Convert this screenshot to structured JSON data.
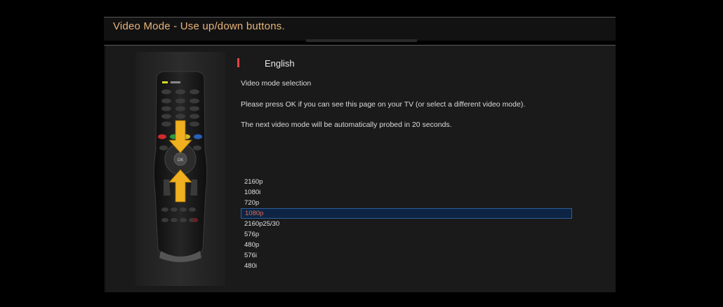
{
  "header": {
    "title": "Video Mode - Use up/down buttons."
  },
  "language": {
    "label": "English"
  },
  "description": {
    "heading": "Video mode selection",
    "instruction": "Please press OK if you can see this page on your TV (or select a different video mode).",
    "countdown": "The next video mode will be automatically probed in 20 seconds."
  },
  "video_modes": {
    "items": [
      "2160p",
      "1080i",
      "720p",
      "1080p",
      "2160p25/30",
      "576p",
      "480p",
      "576i",
      "480i"
    ],
    "selected": "1080p"
  },
  "remote": {
    "ok_label": "OK",
    "colors": {
      "red": "#cc2b2b",
      "green": "#2f9a3c",
      "yellow": "#d4b62a",
      "blue": "#2a5fb8",
      "arrow": "#f0b020"
    }
  },
  "colors": {
    "title_text": "#e8b47a",
    "selection_bg": "#0d2444",
    "selection_border": "#2f5f9a",
    "selected_text": "#e46a4a",
    "language_marker": "#e04444"
  }
}
